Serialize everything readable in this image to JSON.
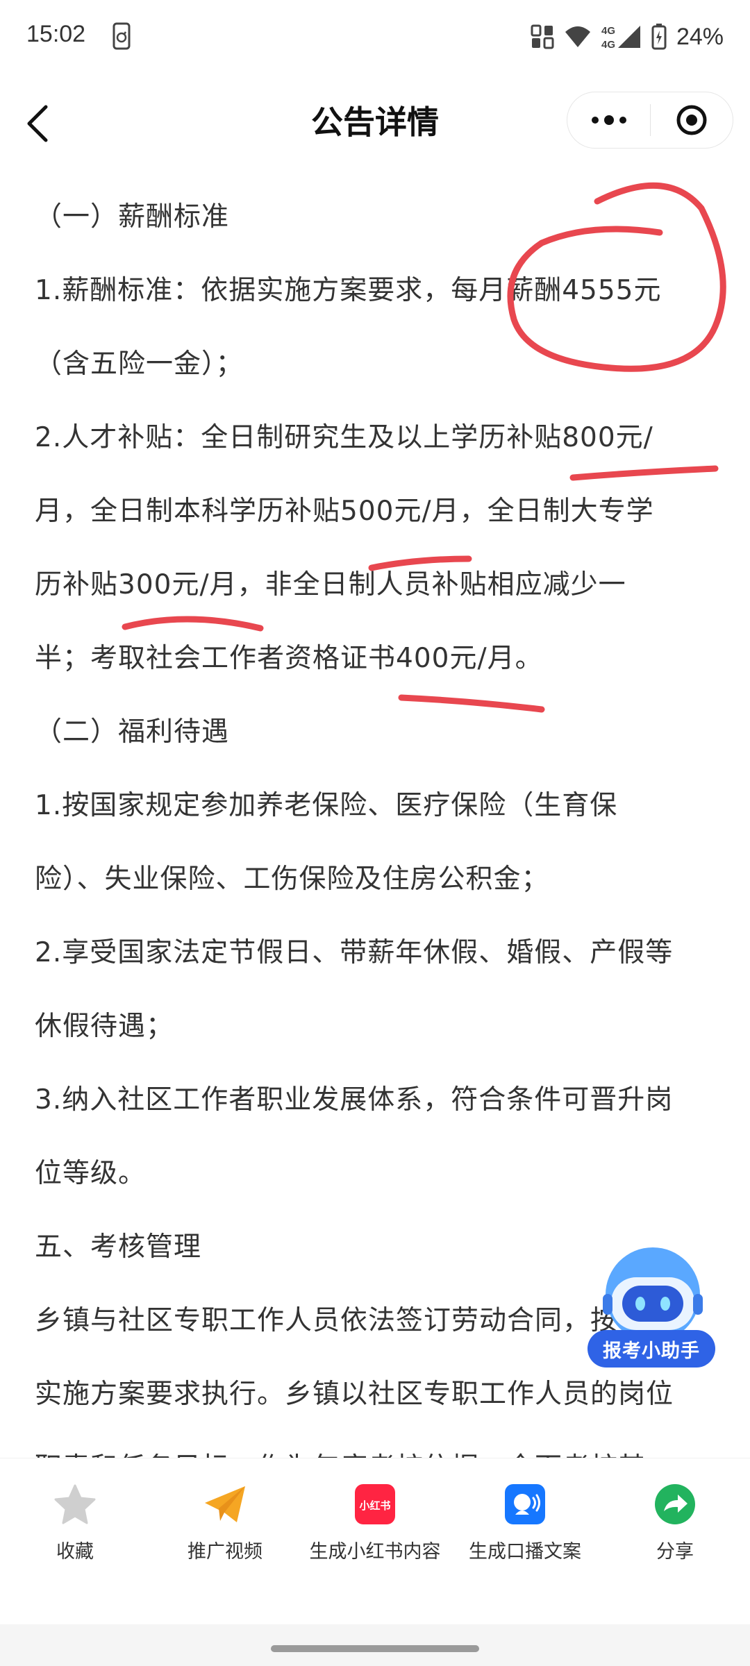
{
  "status_bar": {
    "time": "15:02",
    "battery": "24%",
    "network": "4G 4G"
  },
  "nav": {
    "title": "公告详情"
  },
  "article": {
    "paragraphs": [
      "（一）薪酬标准",
      "1.薪酬标准：依据实施方案要求，每月薪酬4555元",
      "（含五险一金）；",
      "2.人才补贴：全日制研究生及以上学历补贴800元/",
      "月，全日制本科学历补贴500元/月，全日制大专学",
      "历补贴300元/月，非全日制人员补贴相应减少一",
      "半；考取社会工作者资格证书400元/月。",
      "（二）福利待遇",
      "1.按国家规定参加养老保险、医疗保险（生育保",
      "险）、失业保险、工伤保险及住房公积金；",
      "2.享受国家法定节假日、带薪年休假、婚假、产假等",
      "休假待遇；",
      "3.纳入社区工作者职业发展体系，符合条件可晋升岗",
      "位等级。",
      "五、考核管理",
      "乡镇与社区专职工作人员依法签订劳动合同，按",
      "实施方案要求执行。乡镇以社区专职工作人员的岗位",
      "职责和任务目标，作为年度考核依据，全面考核其"
    ]
  },
  "assistant": {
    "label": "报考小助手"
  },
  "toolbar": {
    "items": [
      {
        "label": "收藏",
        "icon": "star-icon"
      },
      {
        "label": "推广视频",
        "icon": "paper-plane-icon"
      },
      {
        "label": "生成小红书内容",
        "icon": "xiaohongshu-icon",
        "icon_text": "小红书"
      },
      {
        "label": "生成口播文案",
        "icon": "voice-icon"
      },
      {
        "label": "分享",
        "icon": "share-icon"
      }
    ]
  },
  "colors": {
    "annotation_red": "#e8474f",
    "toolbar_star": "#cfcfcf",
    "toolbar_plane": "#f5a623",
    "toolbar_xhs": "#ff2442",
    "toolbar_voice": "#1677ff",
    "toolbar_share": "#22b35e",
    "assistant_blue": "#2f63e6"
  }
}
